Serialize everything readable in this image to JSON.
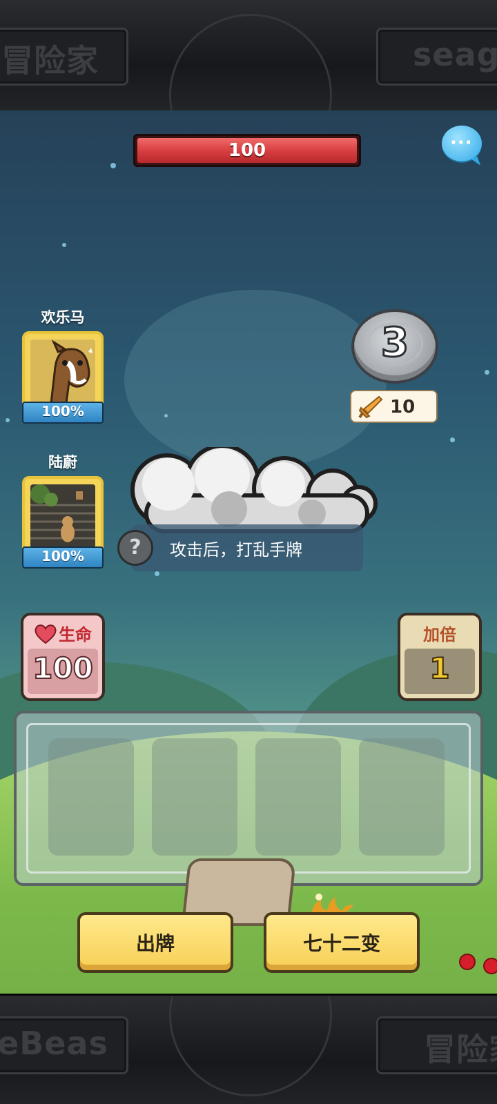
{
  "frame": {
    "top_left_word": "冒险家",
    "top_right_word": "seaga",
    "bottom_left_word": "eBeas",
    "bottom_right_word": "冒险家"
  },
  "enemy": {
    "hp_value": "100",
    "hp_fraction": 1.0
  },
  "chat_icon": {
    "icon": "chat-bubble-icon",
    "glyph": "···"
  },
  "allies": [
    {
      "name": "欢乐马",
      "percent": "100%",
      "portrait": "horse-portrait"
    },
    {
      "name": "陆蔚",
      "percent": "100%",
      "portrait": "stairs-cat-portrait"
    }
  ],
  "turn_counter": {
    "value": "3"
  },
  "attack": {
    "icon": "sword-icon",
    "value": "10"
  },
  "tooltip": {
    "text": "攻击后，打乱手牌",
    "help_glyph": "?"
  },
  "life": {
    "label": "生命",
    "value": "100",
    "icon": "heart-icon"
  },
  "multiplier": {
    "label": "加倍",
    "value": "1"
  },
  "hand": {
    "slots": 4
  },
  "buttons": {
    "play_label": "出牌",
    "transform_label": "七十二变"
  },
  "colors": {
    "hp_red": "#d63c3f",
    "button_yellow": "#f7cf55",
    "card_gold": "#e8c33c",
    "percent_blue": "#2f84c2"
  }
}
